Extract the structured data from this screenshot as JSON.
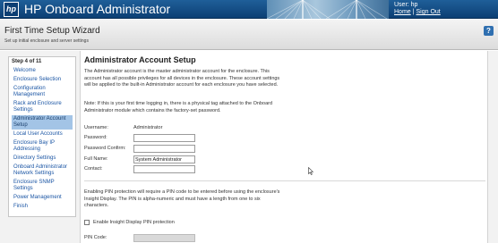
{
  "app": {
    "logo_text": "hp",
    "title": "HP Onboard Administrator"
  },
  "user": {
    "user_label": "User: hp",
    "home_link": "Home",
    "separator": "|",
    "signout_link": "Sign Out"
  },
  "wizard": {
    "title": "First Time Setup Wizard",
    "subtitle": "Set up initial enclosure and server settings",
    "help_icon": "?"
  },
  "sidebar": {
    "step_label": "Step 4 of 11",
    "items": [
      {
        "label": "Welcome",
        "active": false
      },
      {
        "label": "Enclosure Selection",
        "active": false
      },
      {
        "label": "Configuration Management",
        "active": false
      },
      {
        "label": "Rack and Enclosure Settings",
        "active": false
      },
      {
        "label": "Administrator Account Setup",
        "active": true
      },
      {
        "label": "Local User Accounts",
        "active": false
      },
      {
        "label": "Enclosure Bay IP Addressing",
        "active": false
      },
      {
        "label": "Directory Settings",
        "active": false
      },
      {
        "label": "Onboard Administrator Network Settings",
        "active": false
      },
      {
        "label": "Enclosure SNMP Settings",
        "active": false
      },
      {
        "label": "Power Management",
        "active": false
      },
      {
        "label": "Finish",
        "active": false
      }
    ]
  },
  "main": {
    "section_title": "Administrator Account Setup",
    "paragraph1": "The Administrator account is the master administrator account for the enclosure. This account has all possible privileges for all devices in the enclosure. These account settings will be applied to the built-in Administrator account for each enclosure you have selected.",
    "paragraph2": "Note: If this is your first time logging in, there is a physical tag attached to the Onboard Administrator module which contains the factory-set password.",
    "form": {
      "username_label": "Username:",
      "username_value": "Administrator",
      "password_label": "Password:",
      "password_value": "",
      "password_confirm_label": "Password Confirm:",
      "password_confirm_value": "",
      "full_name_label": "Full Name:",
      "full_name_value": "System Administrator",
      "contact_label": "Contact:",
      "contact_value": ""
    },
    "pin_paragraph": "Enabling PIN protection will require a PIN code to be entered before using the enclosure's Insight Display. The PIN is alpha-numeric and must have a length from one to six characters.",
    "pin_checkbox_label": "Enable Insight Display PIN protection",
    "pin_checked": false,
    "pin_code_label": "PIN Code:",
    "pin_code_value": ""
  },
  "colors": {
    "brand_bar": "#0c3f74",
    "nav_link": "#1a55a4",
    "nav_active_bg": "#a3c4e6"
  }
}
